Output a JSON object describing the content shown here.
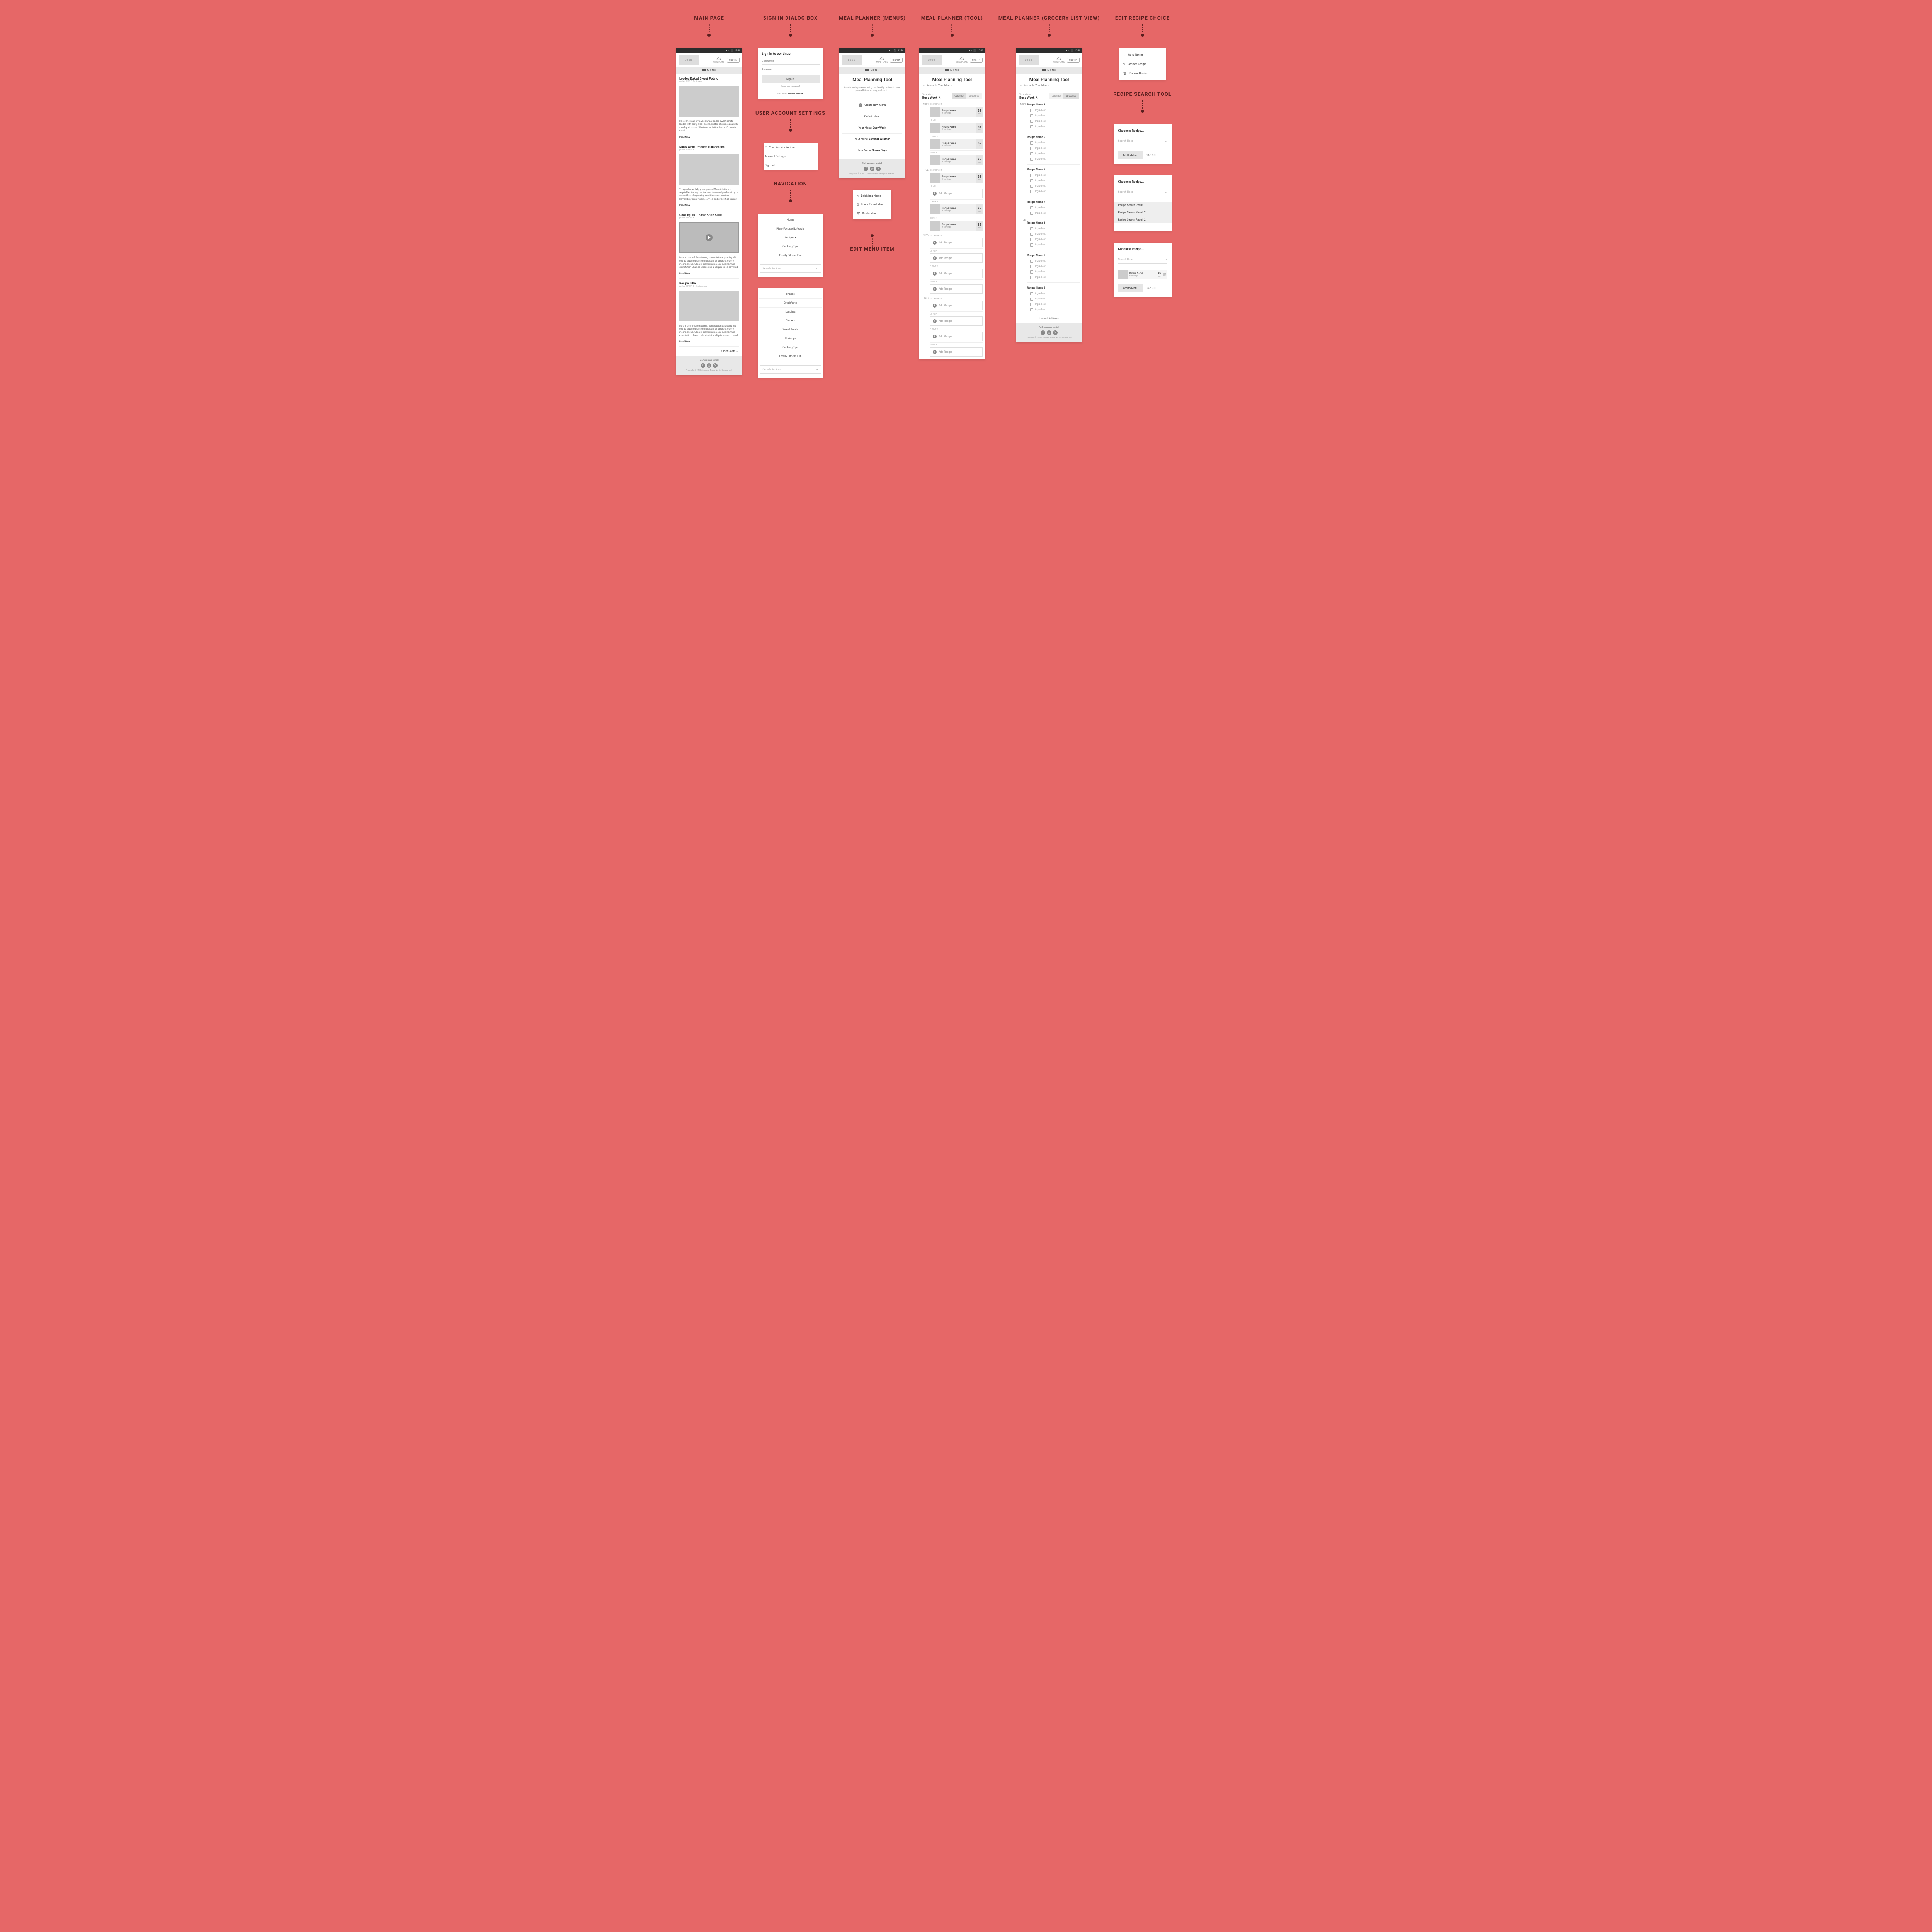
{
  "titles": {
    "main": "MAIN PAGE",
    "signin": "SIGN IN DIALOG BOX",
    "account": "USER ACCOUNT SETTINGS",
    "nav": "NAVIGATION",
    "mpmenus": "MEAL PLANNER (MENUS)",
    "editmenu": "EDIT MENU ITEM",
    "mptool": "MEAL PLANNER (TOOL)",
    "mpgrocery": "MEAL PLANNER (GROCERY LIST VIEW)",
    "editrecipe": "EDIT RECIPE CHOICE",
    "rsearch": "RECIPE SEARCH TOOL"
  },
  "common": {
    "logo": "LOGO",
    "mealplans": "MEAL PLANS",
    "signin": "SIGN IN",
    "menu": "MENU",
    "time": "12:30",
    "followus": "Follow us on social:",
    "copyright": "Copyright © 2019 Company Name. All rights reserved."
  },
  "main": {
    "a1": {
      "title": "Loaded Baked Sweet Potato",
      "meta": "posted 11/21/18  •  Dinners",
      "body": "Baked Mexican style vegetarian loaded sweet potato loaded with zesty black beans, melted cheese, salsa with a dollop of cream. What can be better than a 20 minute meal!",
      "readmore": "Read More..."
    },
    "a2": {
      "title": "Know What Produce is in Season",
      "meta": "posted 11/05/18",
      "body": "This guide can help you explore different fruits and vegetables throughout the year. Seasonal produce in your area will vary by growing conditions and weather. Remember, fresh, frozen, canned, and dried: it all counts!",
      "readmore": "Read More..."
    },
    "a3": {
      "title": "Cooking 101: Basic Knife Skills",
      "meta": "posted 10/12/18",
      "body": "Lorem ipsum dolor sit amet, consectetur adipiscing elit, sed do eiusmod tempor incididunt ut labore et dolore magna aliqua. Ut enim ad minim veniam, quis nostrud exercitation ullamco laboris nisi ut aliquip ex ea commod.",
      "readmore": "Read More..."
    },
    "a4": {
      "title": "Recipe Title",
      "meta": "posted 10/02/18  •  Section name",
      "body": "Lorem ipsum dolor sit amet, consectetur adipiscing elit, sed do eiusmod tempor incididunt ut labore et dolore magna aliqua. Ut enim ad minim veniam, quis nostrud exercitation ullamco laboris nisi ut aliquip ex ea commod.",
      "readmore": "Read More..."
    },
    "older": "Older Posts →"
  },
  "signin": {
    "title": "Sign in to continue",
    "user_ph": "Username",
    "pass_ph": "Password",
    "btn": "Sign in",
    "forgot": "Forgot your password?",
    "newhere": "New here? ",
    "create": "Create an account"
  },
  "account": {
    "fav": "Your Favorite Recipes",
    "settings": "Account Settings",
    "signout": "Sign out"
  },
  "nav": {
    "items": [
      "Home",
      "Plant-Focused Lifestyle",
      "Recipes ▾",
      "Cooking Tips",
      "Family Fitness Fun"
    ],
    "search_ph": "Search Recipes...",
    "sub_items": [
      "Snacks",
      "Breakfasts",
      "Lunches",
      "Dinners",
      "Sweet Treats",
      "Holidays",
      "Cooking Tips",
      "Family Fitness Fun"
    ]
  },
  "mpmenus": {
    "h": "Meal Planning Tool",
    "sub": "Create weekly menus using our healthy recipes to save yourself time, money, and sanity.",
    "create": "Create New Menu",
    "default": "Default Menu",
    "m1_pre": "Your Menu: ",
    "m1": "Busy Week",
    "m2_pre": "Your Menu: ",
    "m2": "Summer Weather",
    "m3_pre": "Your Menu: ",
    "m3": "Snowy Days"
  },
  "editmenu": {
    "edit": "Edit Menu Name",
    "print": "Print / Export Menu",
    "delete": "Delete Menu"
  },
  "mptool": {
    "h": "Meal Planning Tool",
    "return": "Return to Your Menus",
    "your_menu": "Your Menu",
    "menu_name": "Busy Week ✎",
    "tab_cal": "Calendar",
    "tab_gro": "Groceries",
    "recipe_name": "Recipe Name",
    "servings": "# servings",
    "num": "25",
    "min": "min",
    "add": "Add Recipe",
    "days": [
      "MON",
      "TUE",
      "WED",
      "THU"
    ],
    "meals": {
      "b": "BREAKFAST",
      "l": "LUNCH",
      "d": "DINNER",
      "s": "SNACK"
    }
  },
  "grocery": {
    "r1": "Recipe Name 1",
    "r2": "Recipe Name 2",
    "r3": "Recipe Name 3",
    "r4": "Recipe Name 4",
    "ing": "Ingredient",
    "uncheck": "Uncheck All Boxes"
  },
  "editrecipe": {
    "goto": "Go to Recipe",
    "replace": "Replace Recipe",
    "remove": "Remove Recipe"
  },
  "rsearch": {
    "title": "Choose a Recipe...",
    "search_ph": "Search Here",
    "add": "Add to Menu",
    "cancel": "CANCEL",
    "res1": "Recipe Search Result 1",
    "res2": "Recipe Search Result 2",
    "res3": "Recipe Search Result 2",
    "rn": "Recipe Name",
    "rs": "# servings",
    "num": "25",
    "min": "min"
  }
}
